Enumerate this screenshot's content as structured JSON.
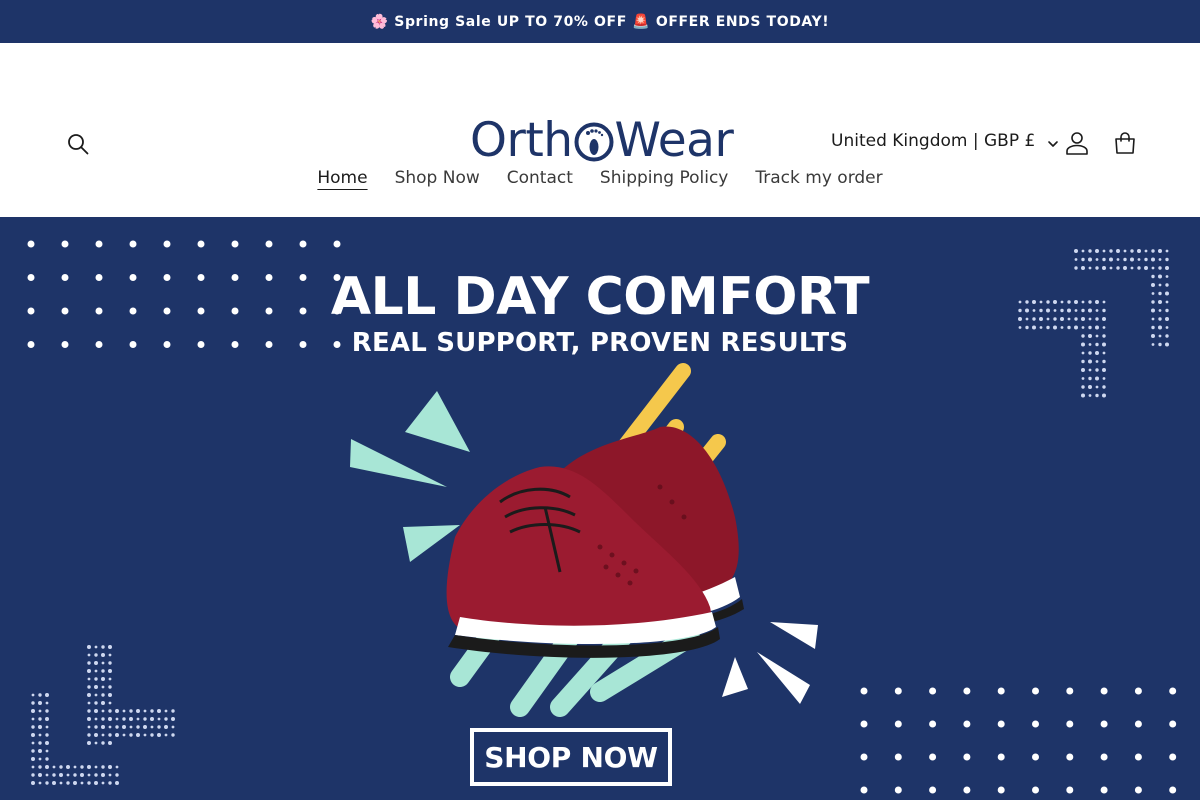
{
  "announcement": {
    "text": "🌸 Spring Sale UP TO 70% OFF 🚨 OFFER ENDS TODAY!"
  },
  "header": {
    "logo_part1": "Orth",
    "logo_part2": "Wear",
    "locale": "United Kingdom | GBP £",
    "icons": {
      "search": "search-icon",
      "account": "user-icon",
      "cart": "cart-icon",
      "chevron": "chevron-down-icon"
    }
  },
  "nav": {
    "items": [
      {
        "label": "Home",
        "active": true
      },
      {
        "label": "Shop Now",
        "active": false
      },
      {
        "label": "Contact",
        "active": false
      },
      {
        "label": "Shipping Policy",
        "active": false
      },
      {
        "label": "Track my order",
        "active": false
      }
    ]
  },
  "hero": {
    "title": "ALL DAY COMFORT",
    "subtitle": "REAL SUPPORT, PROVEN RESULTS",
    "cta": "SHOP NOW"
  },
  "colors": {
    "brand_navy": "#1e3468",
    "shoe_red": "#9b1b30",
    "mint": "#a8e6d6",
    "yellow": "#f5c84c"
  }
}
